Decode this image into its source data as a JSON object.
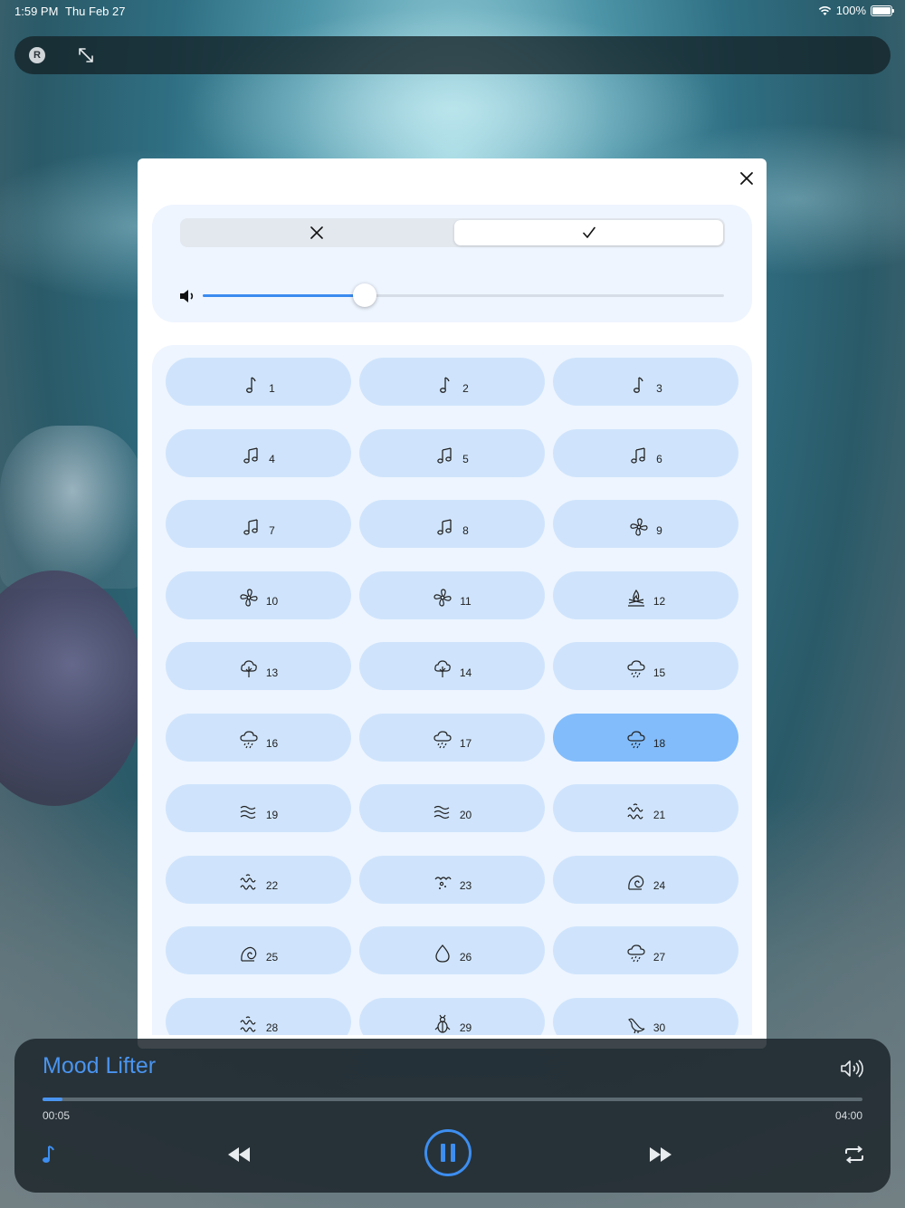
{
  "status_bar": {
    "time": "1:59 PM",
    "date": "Thu Feb 27",
    "battery": "100%"
  },
  "top_bar": {
    "badge": "R"
  },
  "colors": {
    "accent": "#3b8bf0",
    "tile": "#cfe4fc",
    "tile_selected": "#82bcfb",
    "card": "#eef5ff"
  },
  "volume": {
    "level": 0.31
  },
  "segmented": {
    "selected": "check"
  },
  "sounds": [
    {
      "label": "1",
      "icon": "note"
    },
    {
      "label": "2",
      "icon": "note"
    },
    {
      "label": "3",
      "icon": "note"
    },
    {
      "label": "4",
      "icon": "notes"
    },
    {
      "label": "5",
      "icon": "notes"
    },
    {
      "label": "6",
      "icon": "notes"
    },
    {
      "label": "7",
      "icon": "notes"
    },
    {
      "label": "8",
      "icon": "notes"
    },
    {
      "label": "9",
      "icon": "fan"
    },
    {
      "label": "10",
      "icon": "fan"
    },
    {
      "label": "11",
      "icon": "fan"
    },
    {
      "label": "12",
      "icon": "campfire"
    },
    {
      "label": "13",
      "icon": "tree"
    },
    {
      "label": "14",
      "icon": "tree"
    },
    {
      "label": "15",
      "icon": "rain-cloud"
    },
    {
      "label": "16",
      "icon": "rain-cloud"
    },
    {
      "label": "17",
      "icon": "rain-cloud"
    },
    {
      "label": "18",
      "icon": "rain-cloud",
      "selected": true
    },
    {
      "label": "19",
      "icon": "wind"
    },
    {
      "label": "20",
      "icon": "wind"
    },
    {
      "label": "21",
      "icon": "waves"
    },
    {
      "label": "22",
      "icon": "waves"
    },
    {
      "label": "23",
      "icon": "sparkle"
    },
    {
      "label": "24",
      "icon": "shell"
    },
    {
      "label": "25",
      "icon": "shell"
    },
    {
      "label": "26",
      "icon": "drop"
    },
    {
      "label": "27",
      "icon": "rain-cloud"
    },
    {
      "label": "28",
      "icon": "waves"
    },
    {
      "label": "29",
      "icon": "cricket"
    },
    {
      "label": "30",
      "icon": "bird"
    }
  ],
  "player": {
    "title": "Mood Lifter",
    "current_time": "00:05",
    "total_time": "04:00",
    "progress": 0.024
  }
}
